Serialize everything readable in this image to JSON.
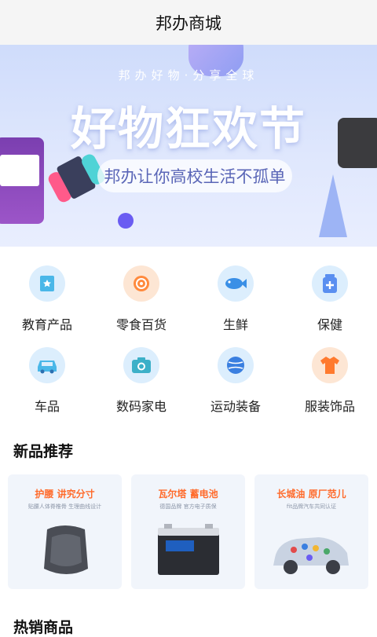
{
  "header": {
    "title": "邦办商城"
  },
  "banner": {
    "tagline": "邦办好物·分享全球",
    "headline": "好物狂欢节",
    "slogan": "邦办让你高校生活不孤单"
  },
  "categories": [
    {
      "label": "教育产品",
      "icon": "book-star-icon",
      "tone": "blue"
    },
    {
      "label": "零食百货",
      "icon": "snack-icon",
      "tone": "orange"
    },
    {
      "label": "生鲜",
      "icon": "fish-icon",
      "tone": "blue"
    },
    {
      "label": "保健",
      "icon": "medicine-bottle-icon",
      "tone": "blue"
    },
    {
      "label": "车品",
      "icon": "car-icon",
      "tone": "blue"
    },
    {
      "label": "数码家电",
      "icon": "camera-icon",
      "tone": "blue"
    },
    {
      "label": "运动装备",
      "icon": "ball-icon",
      "tone": "blue"
    },
    {
      "label": "服装饰品",
      "icon": "tshirt-icon",
      "tone": "orange"
    }
  ],
  "new_products": {
    "title": "新品推荐",
    "items": [
      {
        "name": "护腰 讲究分寸",
        "sub": "贴腰人体脊椎骨 生理曲线设计"
      },
      {
        "name": "瓦尔塔 蓄电池",
        "sub": "德国品牌 官方电子质保"
      },
      {
        "name": "长城油 原厂范儿",
        "sub": "fit品牌汽车共同认证"
      }
    ]
  },
  "hot_products": {
    "title": "热销商品"
  },
  "colors": {
    "accent_blue": "#4a9cf0",
    "accent_orange": "#ff7a2e",
    "card_title": "#ff6a2a"
  }
}
